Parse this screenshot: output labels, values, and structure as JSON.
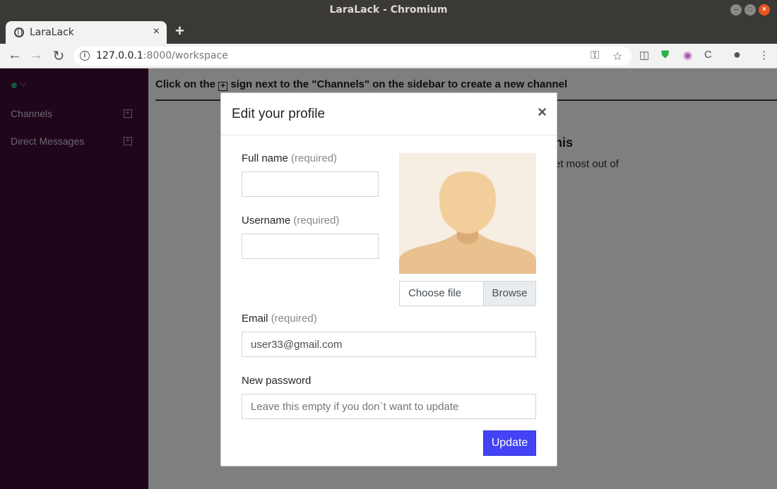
{
  "window": {
    "title": "LaraLack - Chromium"
  },
  "tab": {
    "title": "LaraLack",
    "close": "×",
    "new_tab": "+"
  },
  "toolbar": {
    "url_host": "127.0.0.1",
    "url_port_path": ":8000/workspace",
    "info_glyph": "i"
  },
  "sidebar": {
    "items": [
      {
        "label": "Channels",
        "add": "+"
      },
      {
        "label": "Direct Messages",
        "add": "+"
      }
    ]
  },
  "main": {
    "hint_before": "Click on the ",
    "hint_plus": "+",
    "hint_after": " sign next to the \"Channels\" on the sidebar to create a new channel",
    "bg_heading_fragment": "his",
    "bg_text_fragment": "et most out of"
  },
  "modal": {
    "title": "Edit your profile",
    "close": "×",
    "full_name_label": "Full name",
    "full_name_req": "(required)",
    "full_name_value": "",
    "username_label": "Username",
    "username_req": "(required)",
    "username_value": "",
    "choose_file": "Choose file",
    "browse": "Browse",
    "email_label": "Email",
    "email_req": "(required)",
    "email_value": "user33@gmail.com",
    "password_label": "New password",
    "password_placeholder": "Leave this empty if you don`t want to update",
    "update_button": "Update"
  },
  "colors": {
    "sidebar_bg": "#3f0d3a",
    "update_button": "#4343f5",
    "presence": "#2bac76"
  }
}
